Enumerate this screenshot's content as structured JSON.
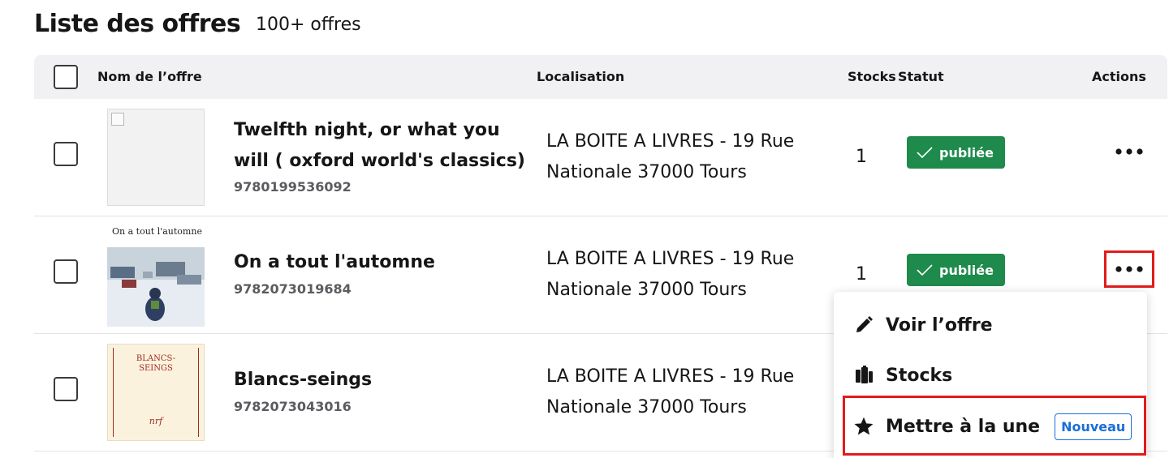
{
  "header": {
    "title": "Liste des offres",
    "count": "100+ offres"
  },
  "table": {
    "columns": {
      "name": "Nom de l’offre",
      "location": "Localisation",
      "stocks": "Stocks",
      "status": "Statut",
      "actions": "Actions"
    },
    "rows": [
      {
        "name": "Twelfth night, or what you will ( oxford world's classics)",
        "ean": "9780199536092",
        "location": "LA BOITE A LIVRES - 19 Rue Nationale 37000 Tours",
        "stock": "1",
        "status": "publiée",
        "thumbnail": "broken-image"
      },
      {
        "name": "On a tout l'automne",
        "ean": "9782073019684",
        "location": "LA BOITE A LIVRES - 19 Rue Nationale 37000 Tours",
        "stock": "1",
        "status": "publiée",
        "thumbnail_caption": "On a tout l'automne"
      },
      {
        "name": "Blancs-seings",
        "ean": "9782073043016",
        "location": "LA BOITE A LIVRES - 19 Rue Nationale 37000 Tours",
        "thumbnail_title_line1": "BLANCS-",
        "thumbnail_title_line2": "SEINGS",
        "thumbnail_mark": "nrf"
      }
    ]
  },
  "actions_menu": {
    "items": [
      {
        "label": "Voir l’offre",
        "icon": "pencil-icon"
      },
      {
        "label": "Stocks",
        "icon": "stocks-icon"
      },
      {
        "label": "Mettre à la une",
        "icon": "star-icon",
        "badge": "Nouveau"
      }
    ]
  },
  "colors": {
    "status_published": "#1e8a4c",
    "highlight": "#e21b1b",
    "new_badge": "#1b6fd8",
    "header_bg": "#f1f1f4"
  }
}
